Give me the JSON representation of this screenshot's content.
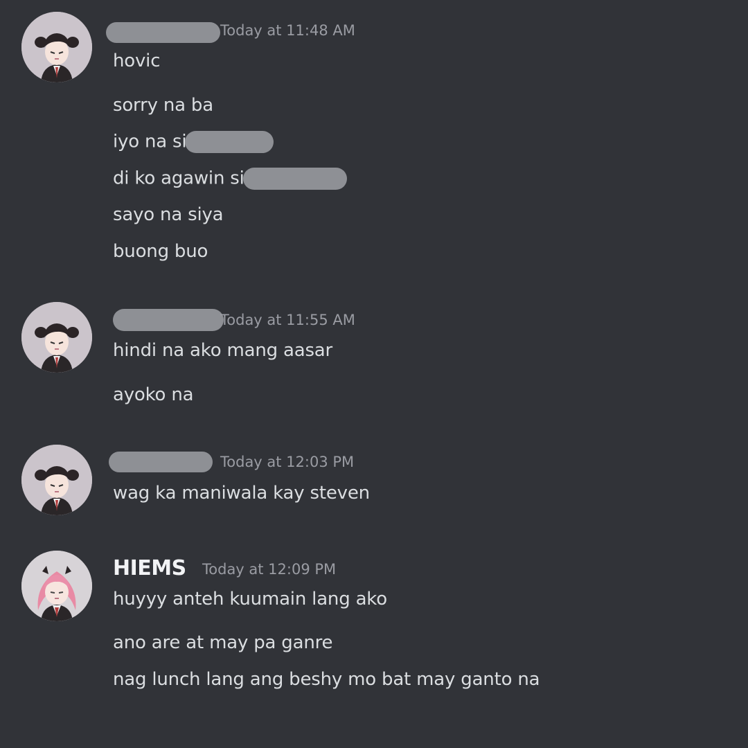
{
  "groups": [
    {
      "author": "",
      "timestamp": "Today at 11:48 AM",
      "avatar": "girl-black-hair-avatar",
      "messages": [
        {
          "text": "hovic"
        },
        {
          "text": "sorry na ba"
        },
        {
          "text": "iyo na si"
        },
        {
          "text": "di ko agawin si"
        },
        {
          "text": "sayo na siya"
        },
        {
          "text": "buong buo"
        }
      ]
    },
    {
      "author": "",
      "timestamp": "Today at 11:55 AM",
      "avatar": "girl-black-hair-avatar",
      "messages": [
        {
          "text": "hindi na ako mang aasar"
        },
        {
          "text": "ayoko na"
        }
      ]
    },
    {
      "author": "",
      "timestamp": "Today at 12:03 PM",
      "avatar": "girl-black-hair-avatar",
      "messages": [
        {
          "text": "wag ka maniwala kay steven"
        }
      ]
    },
    {
      "author": "HIEMS",
      "timestamp": "Today at 12:09 PM",
      "avatar": "girl-pink-hair-avatar",
      "messages": [
        {
          "text": "huyyy anteh kuumain lang ako"
        },
        {
          "text": "ano are at may pa ganre"
        },
        {
          "text": "nag lunch lang ang beshy mo bat may ganto na"
        }
      ]
    }
  ],
  "colors": {
    "background": "#313338",
    "text": "#dbdee1",
    "username": "#f2f3f5",
    "timestamp": "#9a9ca3",
    "redaction": "#8e9095"
  }
}
